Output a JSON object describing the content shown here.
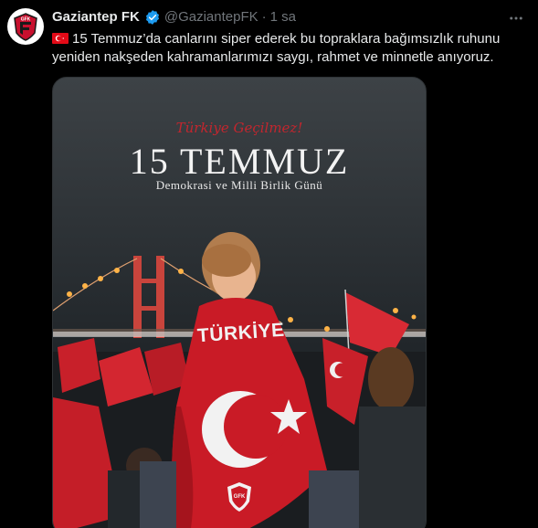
{
  "tweet": {
    "display_name": "Gaziantep FK",
    "handle": "@GaziantepFK",
    "separator": "·",
    "time": "1 sa",
    "text": "15 Temmuz’da canlarını siper ederek bu topraklara bağımsızlık ruhunu yeniden nakşeden kahramanlarımızı saygı, rahmet ve minnetle anıyoruz.",
    "flag_icon": "turkey-flag-icon",
    "verified_icon": "verified-badge-icon",
    "more_icon": "more-options-icon"
  },
  "avatar": {
    "logo_text": "GFK"
  },
  "poster": {
    "subtitle": "Türkiye Geçilmez!",
    "title": "15 TEMMUZ",
    "caption": "Demokrasi ve Milli Birlik Günü",
    "cape_label": "TÜRKİYE",
    "badge_text": "GFK"
  },
  "colors": {
    "background": "#000000",
    "text_primary": "#e7e9ea",
    "text_secondary": "#71767b",
    "verified_blue": "#1d9bf0",
    "flag_red": "#e30a17"
  }
}
